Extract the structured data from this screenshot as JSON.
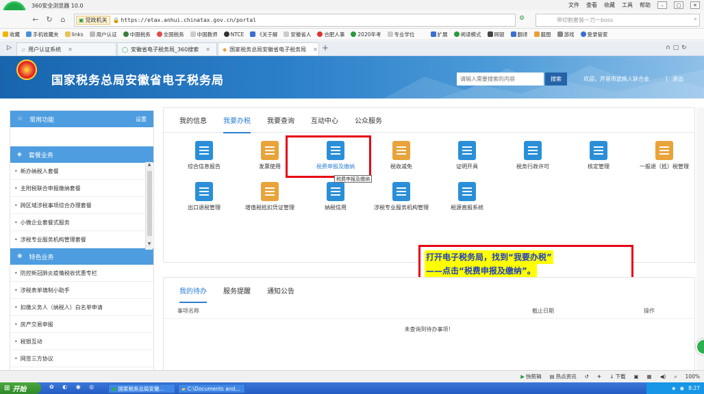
{
  "browser": {
    "name": "360安全浏览器 10.0",
    "menu": [
      "文件",
      "查看",
      "收藏",
      "工具",
      "帮助"
    ],
    "address": {
      "badge": "党政机关",
      "url": "https://etax.anhui.chinatax.gov.cn/portal"
    },
    "search_placeholder": "带切割套装一刀一boss",
    "favorites": [
      "收藏",
      "手机收藏夹",
      "links",
      "用户认证",
      "中国税务",
      "全国税务",
      "中国教师",
      "NTCE",
      "《关于解",
      "安徽省人",
      "合肥人事",
      "2020年考",
      "专业学位"
    ],
    "toolbar_right": [
      "扩展",
      "阅读模式",
      "网银",
      "翻译",
      "截图",
      "游戏",
      "登录管家"
    ],
    "tabs": [
      {
        "label": "用户认证系统"
      },
      {
        "label": "安徽省电子税务局_360搜索"
      },
      {
        "label": "国家税务总局安徽省电子税务局"
      }
    ]
  },
  "site": {
    "title": "国家税务总局安徽省电子税务局",
    "search_placeholder": "请输入需要搜索的内容",
    "search_button": "搜索",
    "welcome": "欢迎，芹昔市武疾人联合会",
    "logout": "退出"
  },
  "sidebar": {
    "common": {
      "title": "常用功能",
      "settings": "设置"
    },
    "packages": {
      "title": "套餐业务",
      "items": [
        "新办纳税人套餐",
        "主附税联合申报缴纳套餐",
        "跨区域涉税事项综合办理套餐",
        "小微企业套餐式服务",
        "涉税专业服务机构管理套餐"
      ]
    },
    "features": {
      "title": "特色业务",
      "items": [
        "防控新冠肺炎疫情税收优惠专栏",
        "涉税表单填制小助手",
        "扣缴义务人（纳税人）白名单申请",
        "房产交易申报",
        "税银互动",
        "网签三方协议"
      ]
    }
  },
  "main": {
    "tabs": [
      "我的信息",
      "我要办税",
      "我要查询",
      "互动中心",
      "公众服务"
    ],
    "active_tab": "我要办税",
    "services_row1": [
      "综合信息报告",
      "发票使用",
      "税费申报及缴纳",
      "税收减免",
      "证明开具",
      "税务行政许可",
      "核定管理",
      "一般退（抵）税管理"
    ],
    "services_row2": [
      "出口退税管理",
      "增值税抵扣凭证管理",
      "纳税信用",
      "涉税专业服务机构管理",
      "税源直报系统"
    ],
    "tooltip": "税费申报及缴纳"
  },
  "callout": {
    "line1": "打开电子税务局，找到“我要办税”",
    "line2": "——点击“税费申报及缴纳”。"
  },
  "lower": {
    "tabs": [
      "我的待办",
      "服务提醒",
      "通知公告"
    ],
    "columns": [
      "事项名称",
      "截止日期",
      "操作"
    ],
    "empty": "未查询到待办事项！"
  },
  "statusbar": {
    "items": [
      "快剪辑",
      "热点资讯",
      "下载",
      "100%"
    ]
  },
  "taskbar": {
    "start": "开始",
    "tasks": [
      "国家税务总局安徽...",
      "C:\\Documents and..."
    ],
    "time": "8:27"
  },
  "colors": {
    "accent": "#2a7fd4",
    "sidebar_head": "#4d9de0",
    "highlight": "#e60012",
    "callout_bg": "#ffff00",
    "callout_text": "#1f3fbf"
  }
}
